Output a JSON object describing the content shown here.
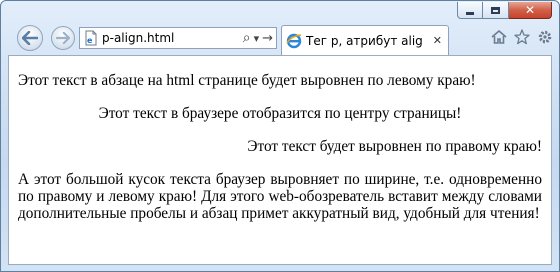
{
  "window": {
    "caption_buttons": [
      "minimize-icon",
      "maximize-icon",
      "close-icon"
    ],
    "close_glyph": "✕"
  },
  "toolbar": {
    "back_icon": "back-arrow-icon",
    "forward_icon": "forward-arrow-icon",
    "address": {
      "text": "p-align.html",
      "search_glyph": "⌕",
      "dropdown_glyph": "▾",
      "go_glyph": "→"
    },
    "right_icons": [
      "home-icon",
      "favorites-star-icon",
      "settings-gear-icon"
    ]
  },
  "tab": {
    "title": "Тег p, атрибут alig",
    "close_glyph": "✕"
  },
  "colors": {
    "frame": "#c6d9ef",
    "close_button": "#c7432c",
    "nav_arrow": "#5a7fa6",
    "page_background": "#ffffff"
  },
  "page": {
    "paragraphs": [
      {
        "align": "left",
        "text": "Этот текст в абзаце на html странице будет выровнен по левому краю!"
      },
      {
        "align": "center",
        "text": "Этот текст в браузере отобразится по центру страницы!"
      },
      {
        "align": "right",
        "text": "Этот текст будет выровнен по правому краю!"
      },
      {
        "align": "justify",
        "text": "А этот большой кусок текста браузер выровняет по ширине, т.е. одновременно по правому и левому краю! Для этого web-обозреватель вставит между словами дополнительные пробелы и абзац примет аккуратный вид, удобный для чтения!"
      }
    ]
  }
}
